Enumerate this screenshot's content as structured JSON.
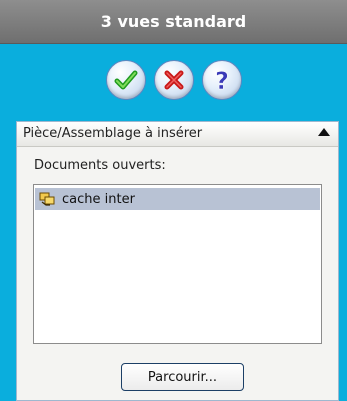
{
  "title": "3 vues standard",
  "actions": {
    "ok_icon": "checkmark-icon",
    "cancel_icon": "close-icon",
    "help_icon": "help-icon"
  },
  "group": {
    "header": "Pièce/Assemblage à insérer",
    "collapse_icon": "collapse-arrow-icon",
    "docs_label": "Documents ouverts:",
    "items": [
      {
        "label": "cache inter",
        "icon": "assembly-icon",
        "selected": true
      }
    ],
    "browse_label": "Parcourir..."
  },
  "colors": {
    "panel_blue": "#0aaedd",
    "titlebar_gray": "#7d7d7d",
    "selection": "#b8c2d4"
  }
}
